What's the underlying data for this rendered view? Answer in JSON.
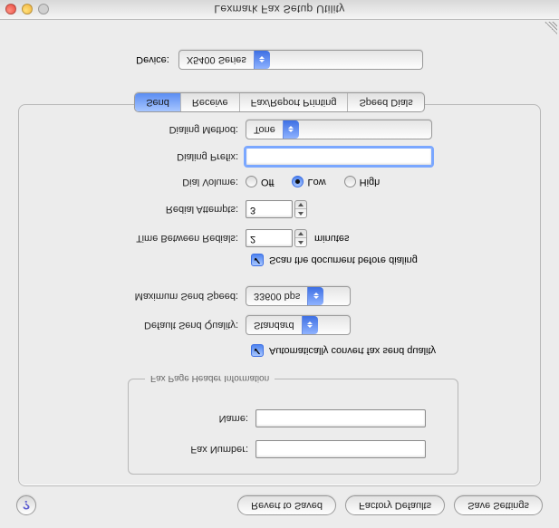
{
  "title": "Lexmark Fax Setup Utility",
  "device": {
    "label": "Device:",
    "value": "X5400 Series"
  },
  "tabs": [
    "Send",
    "Receive",
    "Fax/Report Printing",
    "Speed Dials"
  ],
  "active_tab": 0,
  "send": {
    "dialing_method": {
      "label": "Dialing Method:",
      "value": "Tone"
    },
    "dialing_prefix": {
      "label": "Dialing Prefix:",
      "value": ""
    },
    "dial_volume": {
      "label": "Dial Volume:",
      "options": [
        "Off",
        "Low",
        "High"
      ],
      "selected": 1
    },
    "redial_attempts": {
      "label": "Redial Attempts:",
      "value": "3"
    },
    "time_between": {
      "label": "Time Between Redials:",
      "value": "2",
      "unit": "minutes"
    },
    "scan_before": {
      "label": "Scan the document before dialing",
      "checked": true
    },
    "max_speed": {
      "label": "Maximum Send Speed:",
      "value": "33600 bps"
    },
    "def_quality": {
      "label": "Default Send Quality:",
      "value": "Standard"
    },
    "auto_convert": {
      "label": "Automatically convert fax send quality",
      "checked": true
    }
  },
  "header_group": {
    "legend": "Fax Page Header Information",
    "fax_number": {
      "label": "Fax Number:",
      "value": ""
    },
    "name": {
      "label": "Name:",
      "value": ""
    }
  },
  "buttons": {
    "revert": "Revert to Saved",
    "factory": "Factory Defaults",
    "save": "Save Settings"
  }
}
